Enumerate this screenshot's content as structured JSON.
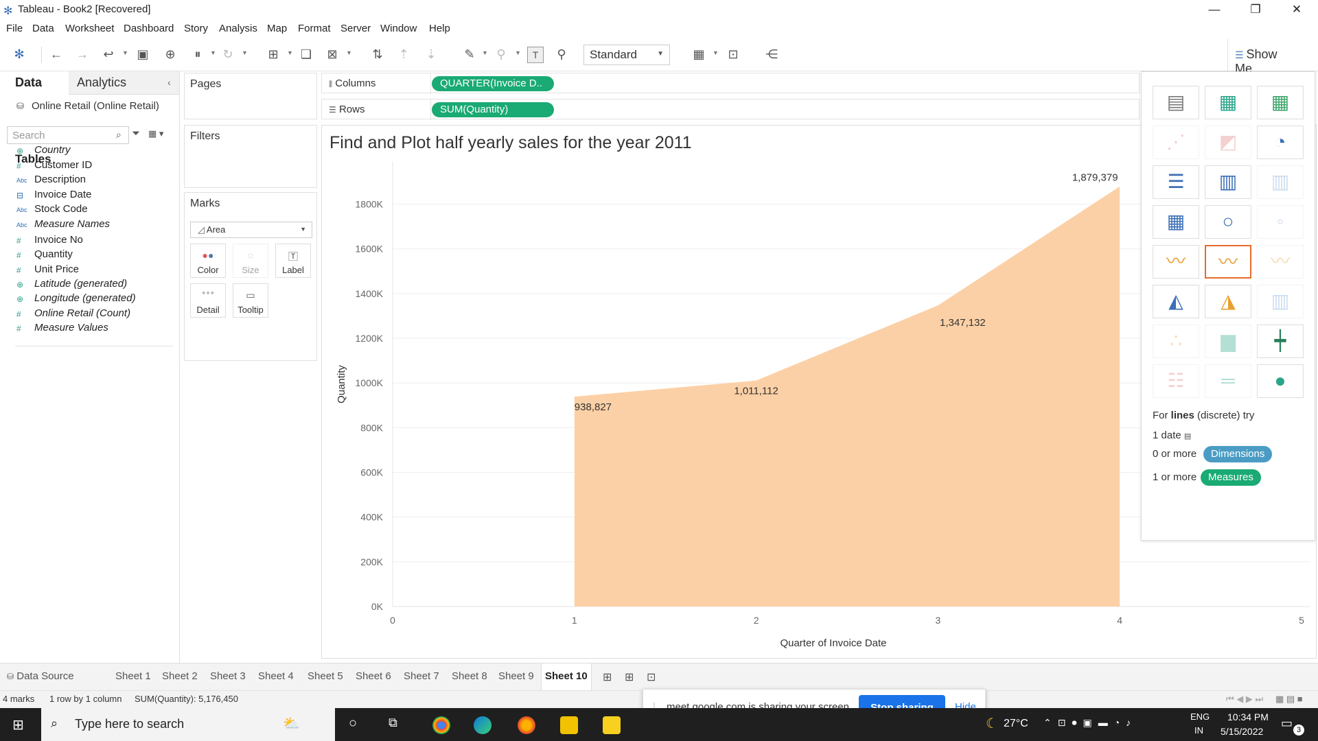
{
  "window": {
    "title": "Tableau - Book2 [Recovered]"
  },
  "menu": [
    "File",
    "Data",
    "Worksheet",
    "Dashboard",
    "Story",
    "Analysis",
    "Map",
    "Format",
    "Server",
    "Window",
    "Help"
  ],
  "toolbar": {
    "fit": "Standard",
    "show_me": "Show Me"
  },
  "data_pane": {
    "tab_data": "Data",
    "tab_analytics": "Analytics",
    "datasource": "Online Retail (Online Retail)",
    "search_placeholder": "Search",
    "tables_heading": "Tables",
    "fields": [
      {
        "name": "Country",
        "type": "geo"
      },
      {
        "name": "Customer ID",
        "type": "num"
      },
      {
        "name": "Description",
        "type": "abc"
      },
      {
        "name": "Invoice Date",
        "type": "date"
      },
      {
        "name": "Stock Code",
        "type": "abc"
      },
      {
        "name": "Measure Names",
        "type": "abc"
      },
      {
        "name": "Invoice No",
        "type": "num"
      },
      {
        "name": "Quantity",
        "type": "num"
      },
      {
        "name": "Unit Price",
        "type": "num"
      },
      {
        "name": "Latitude (generated)",
        "type": "geo"
      },
      {
        "name": "Longitude (generated)",
        "type": "geo"
      },
      {
        "name": "Online Retail (Count)",
        "type": "num"
      },
      {
        "name": "Measure Values",
        "type": "num"
      }
    ]
  },
  "cards": {
    "pages": "Pages",
    "filters": "Filters",
    "marks": "Marks",
    "mark_type": "Area",
    "buttons": [
      "Color",
      "Size",
      "Label",
      "Detail",
      "Tooltip"
    ]
  },
  "shelves": {
    "columns_label": "Columns",
    "columns_pill": "QUARTER(Invoice D..",
    "rows_label": "Rows",
    "rows_pill": "SUM(Quantity)"
  },
  "chart_data": {
    "type": "area",
    "title": "Find and Plot half yearly sales for the year 2011",
    "xlabel": "Quarter of Invoice Date",
    "ylabel": "Quantity",
    "x": [
      1,
      2,
      3,
      4
    ],
    "values": [
      938827,
      1011112,
      1347132,
      1879379
    ],
    "data_labels": [
      "938,827",
      "1,011,112",
      "1,347,132",
      "1,879,379"
    ],
    "xlim": [
      0,
      5
    ],
    "ylim": [
      0,
      1900000
    ],
    "x_ticks": [
      "0",
      "1",
      "2",
      "3",
      "4",
      "5"
    ],
    "y_ticks": [
      "0K",
      "200K",
      "400K",
      "600K",
      "800K",
      "1000K",
      "1200K",
      "1400K",
      "1600K",
      "1800K"
    ],
    "color": "#fcd0a6"
  },
  "show_me": {
    "hint_prefix": "For",
    "hint_bold": "lines",
    "hint_suffix": "(discrete) try",
    "req1": "1 date",
    "req2_prefix": "0 or more",
    "req2_pill": "Dimensions",
    "req3_prefix": "1 or more",
    "req3_pill": "Measures",
    "dim_color": "#4a9cc4",
    "measure_color": "#1aaa74"
  },
  "sheet_tabs": {
    "data_source": "Data Source",
    "sheets": [
      "Sheet 1",
      "Sheet 2",
      "Sheet 3",
      "Sheet 4",
      "Sheet 5",
      "Sheet 6",
      "Sheet 7",
      "Sheet 8",
      "Sheet 9",
      "Sheet 10"
    ],
    "active": "Sheet 10"
  },
  "status": {
    "marks": "4 marks",
    "dims": "1 row by 1 column",
    "sum": "SUM(Quantity): 5,176,450"
  },
  "sharing": {
    "text": "meet.google.com is sharing your screen.",
    "stop": "Stop sharing",
    "hide": "Hide"
  },
  "taskbar": {
    "search_placeholder": "Type here to search",
    "weather": "27°C",
    "lang1": "ENG",
    "lang2": "IN",
    "time": "10:34 PM",
    "date": "5/15/2022",
    "notifications": "3"
  }
}
